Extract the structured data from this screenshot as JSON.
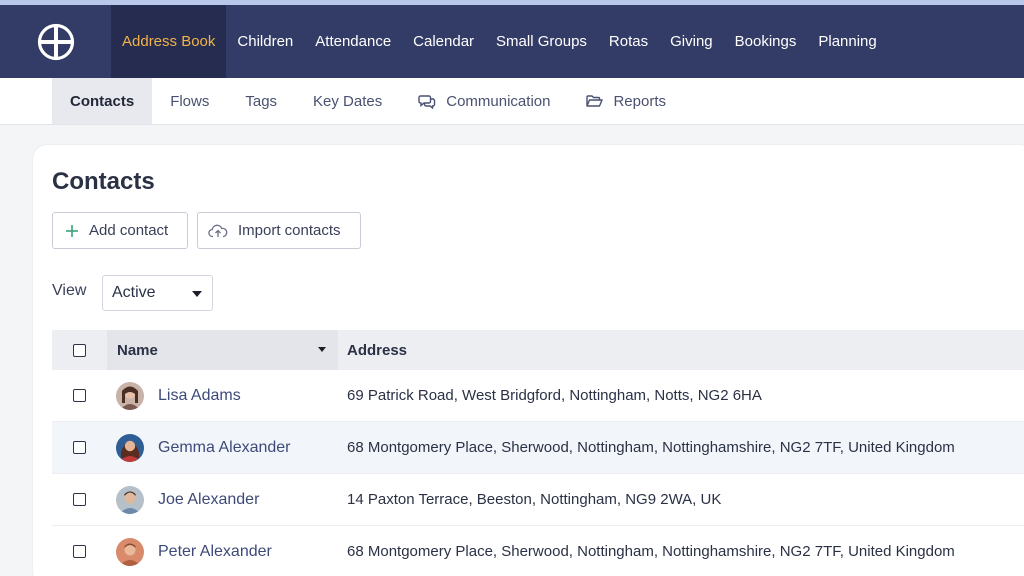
{
  "nav": {
    "logo_icon": "globe-cross-icon",
    "items": [
      {
        "label": "Address Book",
        "active": true
      },
      {
        "label": "Children"
      },
      {
        "label": "Attendance"
      },
      {
        "label": "Calendar"
      },
      {
        "label": "Small Groups"
      },
      {
        "label": "Rotas"
      },
      {
        "label": "Giving"
      },
      {
        "label": "Bookings"
      },
      {
        "label": "Planning"
      }
    ]
  },
  "subnav": {
    "items": [
      {
        "label": "Contacts",
        "active": true
      },
      {
        "label": "Flows"
      },
      {
        "label": "Tags"
      },
      {
        "label": "Key Dates"
      },
      {
        "label": "Communication",
        "icon": "chat-bubbles-icon"
      },
      {
        "label": "Reports",
        "icon": "folder-open-icon"
      }
    ]
  },
  "page": {
    "title": "Contacts",
    "add_contact_label": "Add contact",
    "import_contacts_label": "Import contacts",
    "view_label": "View",
    "view_selected": "Active"
  },
  "table": {
    "columns": {
      "name": "Name",
      "address": "Address"
    },
    "rows": [
      {
        "name": "Lisa Adams",
        "address": "69 Patrick Road, West Bridgford, Nottingham, Notts, NG2 6HA"
      },
      {
        "name": "Gemma Alexander",
        "address": "68 Montgomery Place, Sherwood, Nottingham, Nottinghamshire, NG2 7TF, United Kingdom"
      },
      {
        "name": "Joe Alexander",
        "address": "14 Paxton Terrace, Beeston, Nottingham, NG9 2WA, UK"
      },
      {
        "name": "Peter Alexander",
        "address": "68 Montgomery Place, Sherwood, Nottingham, Nottinghamshire, NG2 7TF, United Kingdom"
      }
    ]
  },
  "colors": {
    "nav_bg": "#333c66",
    "nav_active_bg": "#252c4f",
    "nav_active_text": "#f0b24a",
    "link": "#3d4a78",
    "add_icon": "#3aa37a"
  }
}
